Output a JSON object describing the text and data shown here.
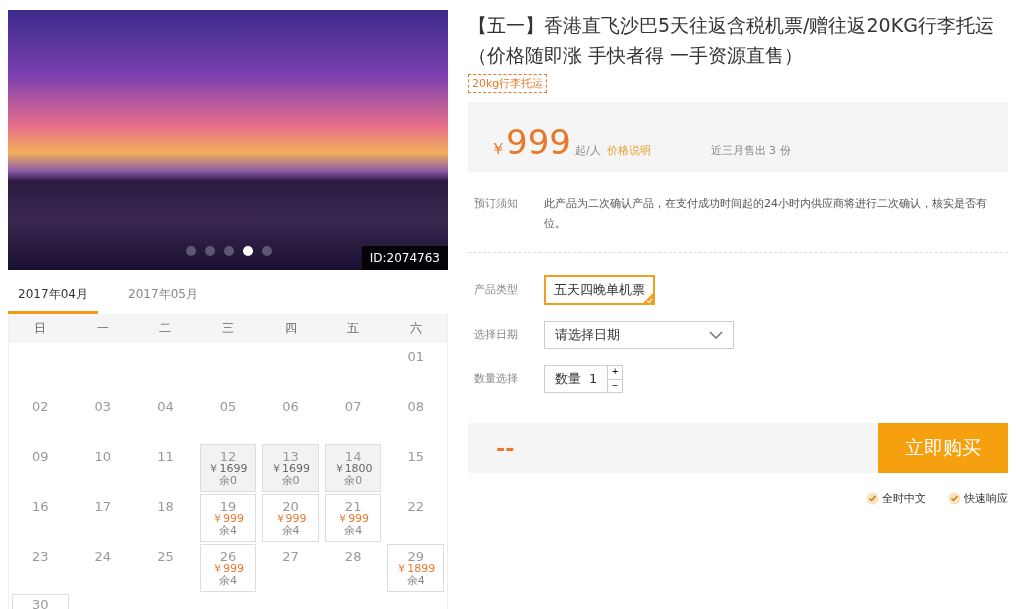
{
  "photo": {
    "id_label": "ID:2074763",
    "dots": [
      {
        "selected": false
      },
      {
        "selected": false
      },
      {
        "selected": false
      },
      {
        "selected": true
      },
      {
        "selected": false
      }
    ]
  },
  "calendar": {
    "months": [
      {
        "label": "2017年04月",
        "selected": true
      },
      {
        "label": "2017年05月",
        "selected": false
      }
    ],
    "weekdays": [
      "日",
      "一",
      "二",
      "三",
      "四",
      "五",
      "六"
    ],
    "weeks": [
      [
        {
          "day": "01",
          "kind": "plain"
        }
      ],
      [
        {
          "day": "02",
          "kind": "plain"
        },
        {
          "day": "03",
          "kind": "plain"
        },
        {
          "day": "04",
          "kind": "plain"
        },
        {
          "day": "05",
          "kind": "plain"
        },
        {
          "day": "06",
          "kind": "plain"
        },
        {
          "day": "07",
          "kind": "plain"
        },
        {
          "day": "08",
          "kind": "plain"
        }
      ],
      [
        {
          "day": "09",
          "kind": "plain"
        },
        {
          "day": "10",
          "kind": "plain"
        },
        {
          "day": "11",
          "kind": "plain"
        },
        {
          "day": "12",
          "kind": "soldout",
          "price": "￥1699",
          "stock": "余0"
        },
        {
          "day": "13",
          "kind": "soldout",
          "price": "￥1699",
          "stock": "余0"
        },
        {
          "day": "14",
          "kind": "soldout",
          "price": "￥1800",
          "stock": "余0"
        },
        {
          "day": "15",
          "kind": "plain"
        }
      ],
      [
        {
          "day": "16",
          "kind": "plain"
        },
        {
          "day": "17",
          "kind": "plain"
        },
        {
          "day": "18",
          "kind": "plain"
        },
        {
          "day": "19",
          "kind": "available",
          "price": "￥999",
          "stock": "余4"
        },
        {
          "day": "20",
          "kind": "available",
          "price": "￥999",
          "stock": "余4"
        },
        {
          "day": "21",
          "kind": "available",
          "price": "￥999",
          "stock": "余4"
        },
        {
          "day": "22",
          "kind": "plain"
        }
      ],
      [
        {
          "day": "23",
          "kind": "plain"
        },
        {
          "day": "24",
          "kind": "plain"
        },
        {
          "day": "25",
          "kind": "plain"
        },
        {
          "day": "26",
          "kind": "available",
          "price": "￥999",
          "stock": "余4"
        },
        {
          "day": "27",
          "kind": "plain"
        },
        {
          "day": "28",
          "kind": "plain"
        },
        {
          "day": "29",
          "kind": "available",
          "price": "￥1899",
          "stock": "余4"
        }
      ],
      [
        {
          "day": "30",
          "kind": "available"
        }
      ]
    ]
  },
  "product": {
    "title": "【五一】香港直飞沙巴5天往返含税机票/赠往返20KG行李托运（价格随即涨 手快者得 一手资源直售）",
    "tag": "20kg行李托运",
    "price": {
      "currency": "￥",
      "amount": "999",
      "unit": "起/人",
      "explain_link": "价格说明",
      "sold": "近三月售出 3 份"
    },
    "notice": {
      "label": "预订须知",
      "text": "此产品为二次确认产品，在支付成功时间起的24小时内供应商将进行二次确认，核实是否有位。"
    },
    "options": [
      {
        "label": "产品类型",
        "kind": "choice",
        "choices": [
          {
            "text": "五天四晚单机票",
            "selected": true
          }
        ]
      },
      {
        "label": "选择日期",
        "kind": "dropdown",
        "value": "请选择日期"
      },
      {
        "label": "数量选择",
        "kind": "stepper",
        "prefix": "数量",
        "value": "1",
        "plus": "+",
        "minus": "−"
      }
    ],
    "total": "--",
    "buy_button": "立即购买",
    "features": [
      "全时中文",
      "快速响应"
    ]
  }
}
